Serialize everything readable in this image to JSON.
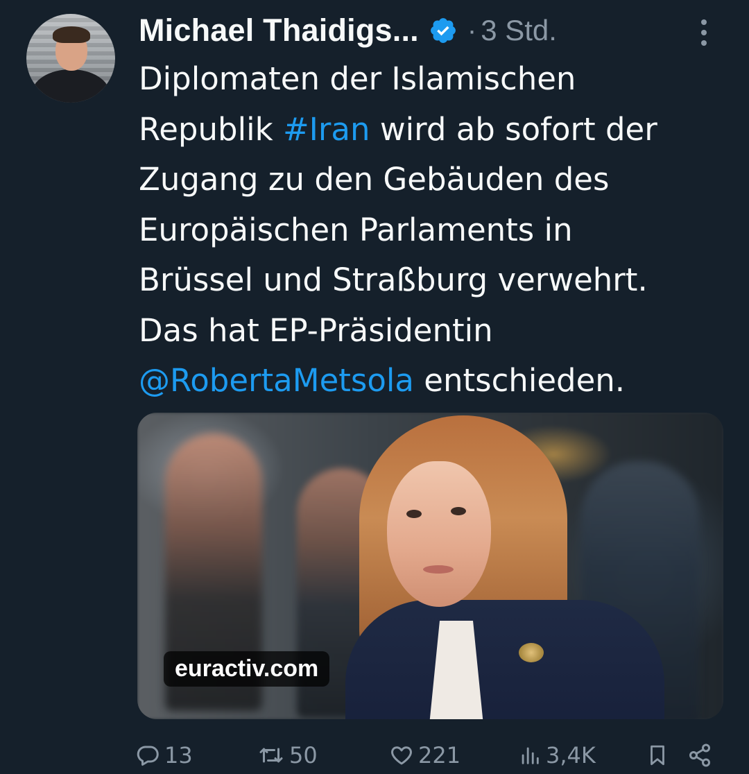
{
  "tweet": {
    "author_name": "Michael Thaidigs...",
    "separator": "·",
    "time": "3 Std.",
    "text_lines": [
      [
        {
          "t": "Diplomaten der Islamischen",
          "link": false
        }
      ],
      [
        {
          "t": "Republik ",
          "link": false
        },
        {
          "t": "#Iran",
          "link": true
        },
        {
          "t": " wird ab sofort der",
          "link": false
        }
      ],
      [
        {
          "t": "Zugang zu den Gebäuden des",
          "link": false
        }
      ],
      [
        {
          "t": "Europäischen Parlaments in",
          "link": false
        }
      ],
      [
        {
          "t": "Brüssel und Straßburg verwehrt.",
          "link": false
        }
      ],
      [
        {
          "t": "Das hat EP-Präsidentin",
          "link": false
        }
      ],
      [
        {
          "t": "@RobertaMetsola",
          "link": true
        },
        {
          "t": " entschieden.",
          "link": false
        }
      ]
    ],
    "card_domain": "euractiv.com",
    "actions": {
      "replies": "13",
      "retweets": "50",
      "likes": "221",
      "views": "3,4K"
    }
  },
  "colors": {
    "background": "#15202b",
    "text": "#f7f9f9",
    "muted": "#8b98a5",
    "link": "#1d9bf0",
    "verified": "#1d9bf0"
  },
  "icons": {
    "reply": "speech-bubble-icon",
    "retweet": "retweet-arrows-icon",
    "like": "heart-outline-icon",
    "views": "bar-chart-icon",
    "bookmark": "bookmark-icon",
    "share": "share-nodes-icon",
    "verified": "verified-badge-icon",
    "more": "more-vertical-icon"
  }
}
